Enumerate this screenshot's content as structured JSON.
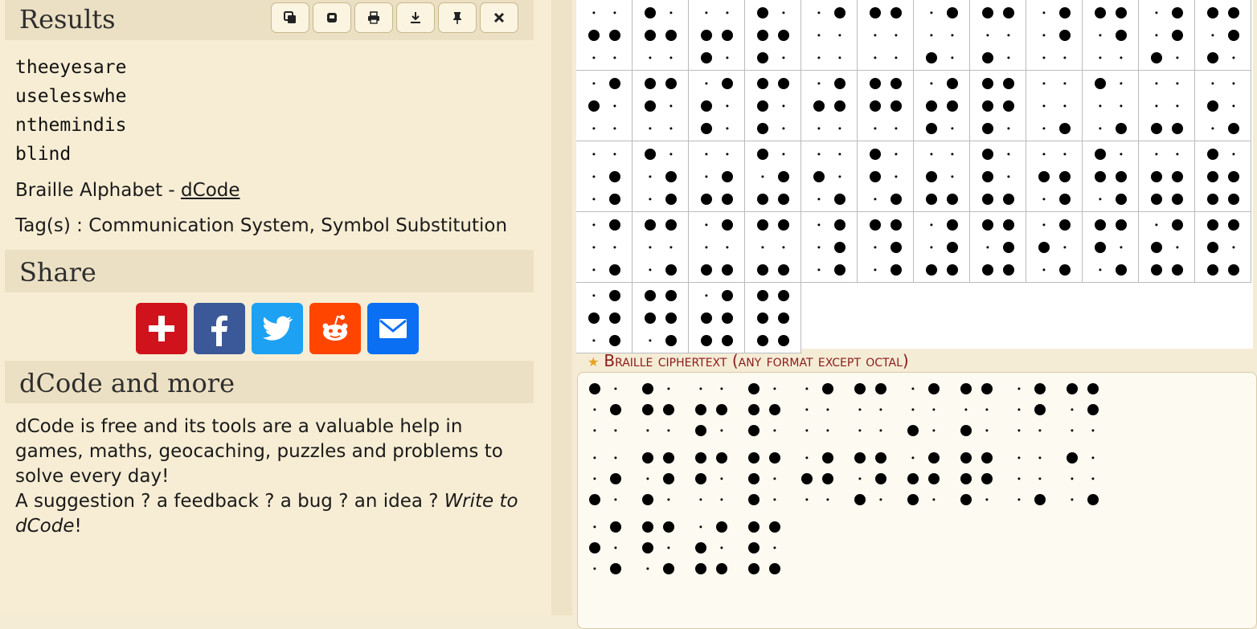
{
  "results": {
    "title": "Results",
    "toolbar": [
      {
        "name": "copy-button",
        "icon": "copy-icon"
      },
      {
        "name": "clear-button",
        "icon": "eraser-icon"
      },
      {
        "name": "print-button",
        "icon": "printer-icon"
      },
      {
        "name": "download-button",
        "icon": "download-icon"
      },
      {
        "name": "pin-button",
        "icon": "pin-icon"
      },
      {
        "name": "close-button",
        "icon": "close-icon"
      }
    ],
    "output_lines": [
      "theeyesare",
      "uselesswhe",
      "nthemindis",
      "blind"
    ],
    "alphabet_prefix": "Braille Alphabet - ",
    "alphabet_link": "dCode",
    "tags": "Tag(s) : Communication System, Symbol Substitution"
  },
  "share": {
    "title": "Share",
    "buttons": [
      {
        "name": "share-add-button",
        "icon": "plus-icon",
        "color": "#d0121d"
      },
      {
        "name": "share-facebook-button",
        "icon": "facebook-icon",
        "color": "#3b5998"
      },
      {
        "name": "share-twitter-button",
        "icon": "twitter-icon",
        "color": "#1da1f2"
      },
      {
        "name": "share-reddit-button",
        "icon": "reddit-icon",
        "color": "#ff4500"
      },
      {
        "name": "share-email-button",
        "icon": "email-icon",
        "color": "#0a6ff2"
      }
    ]
  },
  "more": {
    "title": "dCode and more",
    "line1": "dCode is free and its tools are a valuable help in games, maths, geocaching, puzzles and problems to solve every day!",
    "line2_prefix": "A suggestion ? a feedback ? a bug ? an idea ? ",
    "line2_link": "Write to dCode",
    "line2_suffix": "!"
  },
  "braille_grid": [
    [
      [
        0,
        1,
        0,
        0,
        1,
        0
      ],
      [
        1,
        1,
        0,
        0,
        1,
        0
      ],
      [
        0,
        1,
        1,
        0,
        1,
        0
      ],
      [
        1,
        1,
        1,
        0,
        1,
        0
      ],
      [
        0,
        0,
        0,
        1,
        0,
        0
      ],
      [
        1,
        0,
        0,
        1,
        0,
        0
      ],
      [
        0,
        0,
        1,
        1,
        0,
        0
      ],
      [
        1,
        0,
        1,
        1,
        0,
        0
      ],
      [
        0,
        0,
        0,
        1,
        1,
        0
      ],
      [
        1,
        0,
        0,
        1,
        1,
        0
      ],
      [
        0,
        0,
        1,
        1,
        1,
        0
      ],
      [
        1,
        0,
        1,
        1,
        1,
        0
      ]
    ],
    [
      [
        0,
        1,
        0,
        1,
        0,
        0
      ],
      [
        1,
        1,
        0,
        1,
        0,
        0
      ],
      [
        0,
        1,
        1,
        1,
        0,
        0
      ],
      [
        1,
        1,
        1,
        1,
        0,
        0
      ],
      [
        0,
        1,
        0,
        1,
        1,
        0
      ],
      [
        1,
        1,
        0,
        1,
        1,
        0
      ],
      [
        0,
        1,
        1,
        1,
        1,
        0
      ],
      [
        1,
        1,
        1,
        1,
        1,
        0
      ],
      [
        0,
        0,
        0,
        0,
        0,
        1
      ],
      [
        1,
        0,
        0,
        0,
        0,
        1
      ],
      [
        0,
        0,
        1,
        0,
        0,
        1
      ],
      [
        0,
        1,
        0,
        0,
        0,
        1
      ]
    ],
    [
      [
        0,
        0,
        0,
        0,
        1,
        1
      ],
      [
        1,
        0,
        0,
        0,
        1,
        1
      ],
      [
        0,
        0,
        1,
        0,
        1,
        1
      ],
      [
        1,
        0,
        1,
        0,
        1,
        1
      ],
      [
        0,
        1,
        0,
        0,
        0,
        1
      ],
      [
        1,
        1,
        0,
        0,
        0,
        1
      ],
      [
        0,
        1,
        1,
        0,
        0,
        1
      ],
      [
        1,
        1,
        1,
        0,
        0,
        1
      ],
      [
        0,
        1,
        0,
        0,
        1,
        1
      ],
      [
        1,
        1,
        0,
        0,
        1,
        1
      ],
      [
        0,
        1,
        1,
        0,
        1,
        1
      ],
      [
        1,
        1,
        1,
        0,
        1,
        1
      ]
    ],
    [
      [
        0,
        0,
        0,
        1,
        0,
        1
      ],
      [
        1,
        0,
        0,
        1,
        0,
        1
      ],
      [
        0,
        0,
        1,
        1,
        0,
        1
      ],
      [
        1,
        0,
        1,
        1,
        0,
        1
      ],
      [
        0,
        0,
        0,
        1,
        1,
        1
      ],
      [
        1,
        0,
        0,
        1,
        1,
        1
      ],
      [
        0,
        0,
        1,
        1,
        1,
        1
      ],
      [
        1,
        0,
        1,
        1,
        1,
        1
      ],
      [
        0,
        1,
        0,
        1,
        0,
        1
      ],
      [
        1,
        1,
        0,
        1,
        0,
        1
      ],
      [
        0,
        1,
        1,
        1,
        0,
        1
      ],
      [
        1,
        1,
        1,
        1,
        0,
        1
      ]
    ],
    [
      [
        0,
        1,
        0,
        1,
        1,
        1
      ],
      [
        1,
        1,
        0,
        1,
        1,
        1
      ],
      [
        0,
        1,
        1,
        1,
        1,
        1
      ],
      [
        1,
        1,
        1,
        1,
        1,
        1
      ]
    ]
  ],
  "ciphertext": {
    "label": "Braille ciphertext (any format except octal)",
    "star_icon": "star-icon",
    "rows": [
      [
        [
          1,
          0,
          0,
          0,
          1,
          0
        ],
        [
          1,
          1,
          0,
          0,
          1,
          0
        ],
        [
          0,
          1,
          1,
          0,
          1,
          0
        ],
        [
          1,
          1,
          1,
          0,
          1,
          0
        ],
        [
          0,
          0,
          0,
          1,
          0,
          0
        ],
        [
          1,
          0,
          0,
          1,
          0,
          0
        ],
        [
          0,
          0,
          1,
          1,
          0,
          0
        ],
        [
          1,
          0,
          1,
          1,
          0,
          0
        ],
        [
          0,
          0,
          0,
          1,
          1,
          0
        ],
        [
          1,
          0,
          0,
          1,
          1,
          0
        ]
      ],
      [
        [
          0,
          0,
          1,
          0,
          1,
          0
        ],
        [
          1,
          0,
          1,
          1,
          1,
          0
        ],
        [
          1,
          1,
          0,
          1,
          0,
          0
        ],
        [
          1,
          1,
          1,
          1,
          0,
          0
        ],
        [
          0,
          1,
          0,
          1,
          1,
          0
        ],
        [
          1,
          0,
          1,
          1,
          1,
          0
        ],
        [
          0,
          1,
          1,
          1,
          1,
          0
        ],
        [
          1,
          1,
          1,
          1,
          1,
          0
        ],
        [
          0,
          0,
          0,
          0,
          0,
          1
        ],
        [
          1,
          0,
          0,
          0,
          0,
          1
        ]
      ],
      [
        [
          0,
          1,
          0,
          1,
          0,
          1
        ],
        [
          1,
          1,
          0,
          1,
          0,
          1
        ],
        [
          0,
          1,
          1,
          1,
          0,
          1
        ],
        [
          1,
          1,
          1,
          1,
          0,
          1
        ]
      ]
    ]
  }
}
